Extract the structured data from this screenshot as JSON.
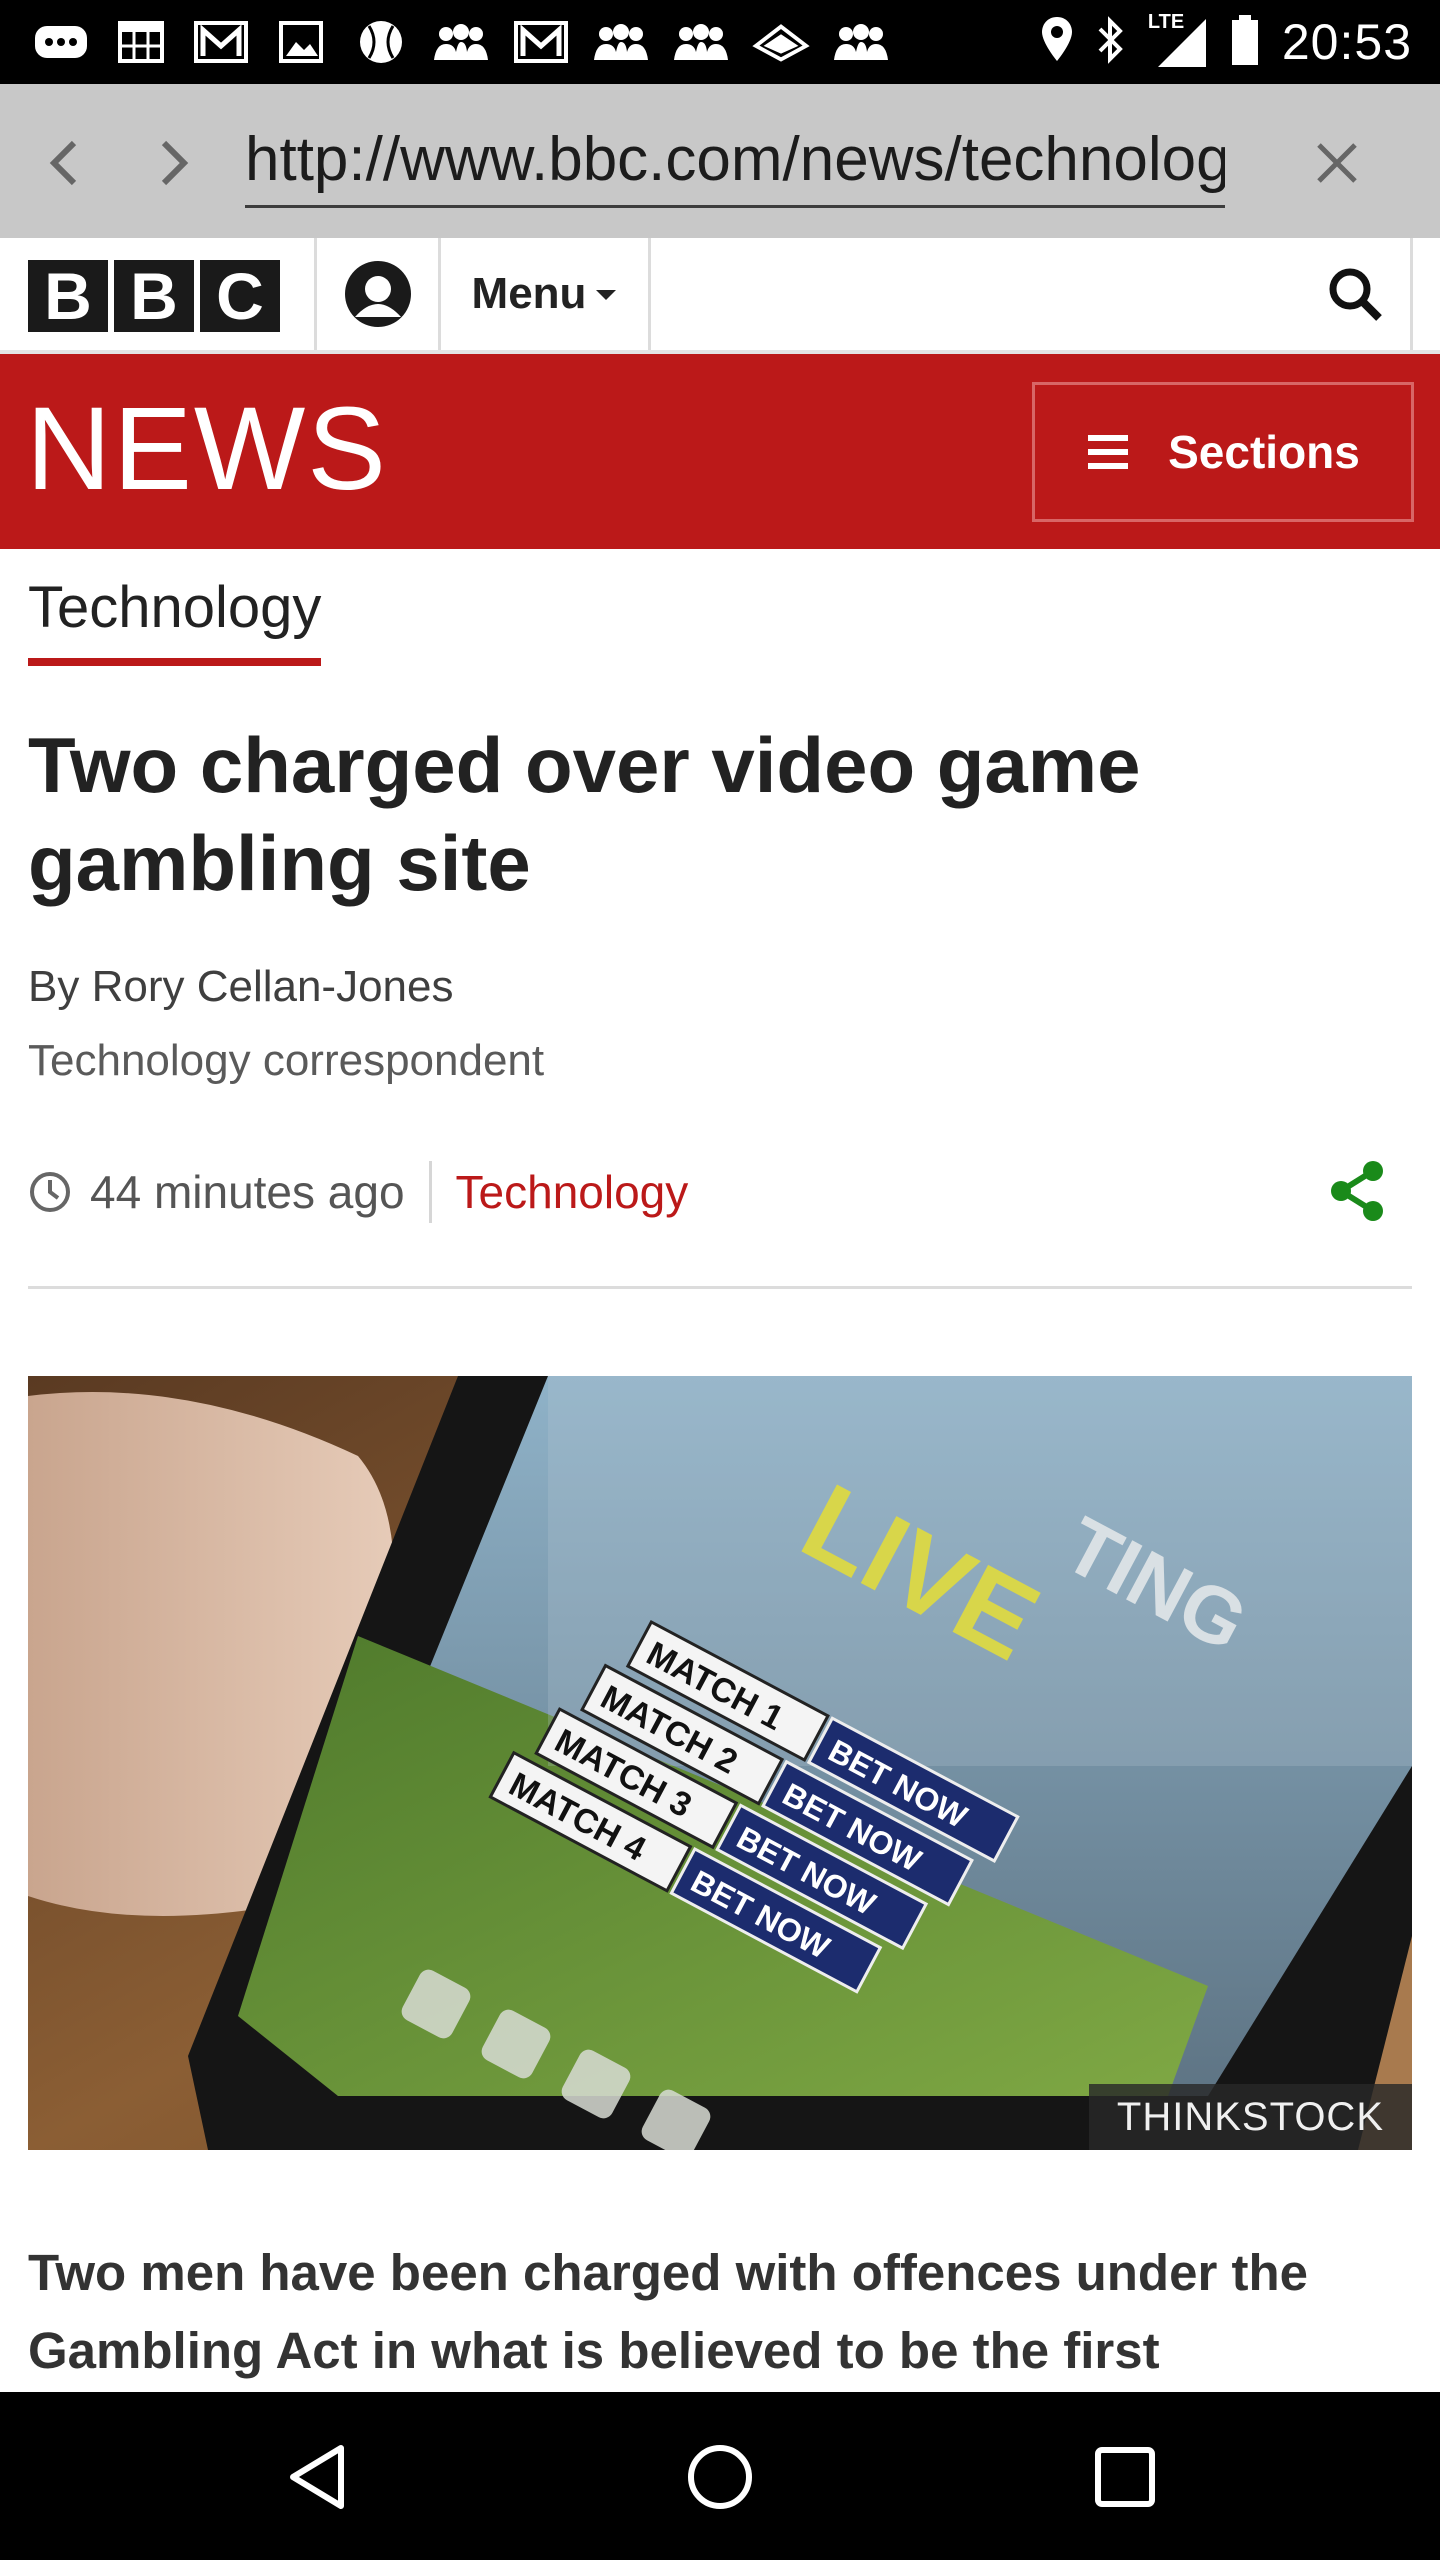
{
  "status_bar": {
    "time": "20:53",
    "network": "LTE",
    "notification_icons": [
      "chat-icon",
      "calendar-grid-icon",
      "gmail-icon",
      "image-icon",
      "baseball-icon",
      "group-icon",
      "gmail-icon",
      "group-icon",
      "group-icon",
      "stadium-icon",
      "group-icon"
    ]
  },
  "browser": {
    "url": "http://www.bbc.com/news/technology",
    "back_icon": "chevron-left-icon",
    "forward_icon": "chevron-right-icon",
    "close_icon": "close-icon"
  },
  "masthead": {
    "logo_letters": [
      "B",
      "B",
      "C"
    ],
    "menu_label": "Menu",
    "icons": [
      "account-icon",
      "search-icon"
    ]
  },
  "newsbar": {
    "logo": "NEWS",
    "sections_label": "Sections"
  },
  "article": {
    "section": "Technology",
    "headline": "Two charged over video game gambling site",
    "byline_name": "By Rory Cellan-Jones",
    "byline_role": "Technology correspondent",
    "time_ago": "44 minutes ago",
    "meta_section": "Technology",
    "image_credit": "THINKSTOCK",
    "image_text": {
      "live_banner": "LIVE",
      "banner_partial": "TING",
      "matches": [
        "MATCH 1",
        "MATCH 2",
        "MATCH 3",
        "MATCH 4"
      ],
      "bet_label": "BET NOW"
    },
    "intro": "Two men have been charged with offences under the Gambling Act in what is believed to be the first"
  },
  "colors": {
    "bbc_red": "#bb1919",
    "share_green": "#1a8a1a",
    "text_dark": "#222222"
  },
  "nav_bar": {
    "buttons": [
      "back-triangle-icon",
      "home-circle-icon",
      "recents-square-icon"
    ]
  }
}
